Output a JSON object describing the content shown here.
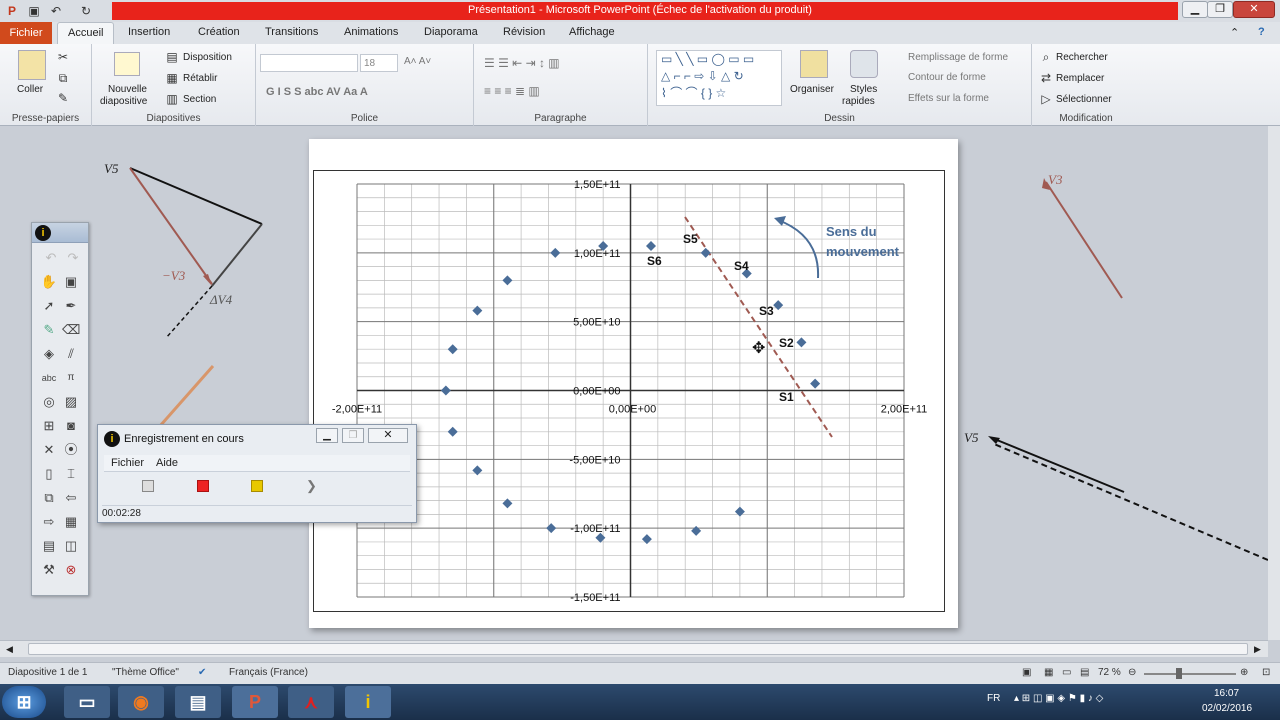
{
  "window": {
    "title": "Présentation1  -  Microsoft PowerPoint (Échec de l'activation du produit)",
    "controls": [
      "minimize",
      "restore",
      "close"
    ]
  },
  "tabs": [
    {
      "label": "Fichier"
    },
    {
      "label": "Accueil"
    },
    {
      "label": "Insertion"
    },
    {
      "label": "Création"
    },
    {
      "label": "Transitions"
    },
    {
      "label": "Animations"
    },
    {
      "label": "Diaporama"
    },
    {
      "label": "Révision"
    },
    {
      "label": "Affichage"
    }
  ],
  "ribbon": {
    "clipboard": {
      "paste": "Coller",
      "group": "Presse-papiers"
    },
    "slides": {
      "new_slide_1": "Nouvelle",
      "new_slide_2": "diapositive",
      "layout": "Disposition",
      "reset": "Rétablir",
      "section": "Section",
      "group": "Diapositives"
    },
    "font": {
      "size": "18",
      "group": "Police"
    },
    "paragraph": {
      "group": "Paragraphe"
    },
    "drawing": {
      "arrange": "Organiser",
      "quick_styles_1": "Styles",
      "quick_styles_2": "rapides",
      "fill": "Remplissage de forme",
      "outline": "Contour de forme",
      "effects": "Effets sur la forme",
      "group": "Dessin"
    },
    "editing": {
      "find": "Rechercher",
      "replace": "Remplacer",
      "select": "Sélectionner",
      "group": "Modification"
    }
  },
  "slide_labels": {
    "v5": "V5",
    "neg_v3": "−V3",
    "delta_v4": "ΔV4",
    "v3": "V3",
    "v5b": "V5",
    "sens1": "Sens du",
    "sens2": "mouvement",
    "s_labels": [
      "S5",
      "S6",
      "S4",
      "S3",
      "S2",
      "S1"
    ]
  },
  "chart_data": {
    "type": "scatter",
    "x": [
      135000000000.0,
      125000000000.0,
      108000000000.0,
      85000000000.0,
      55000000000.0,
      15000000000.0,
      -20000000000.0,
      -55000000000.0,
      -90000000000.0,
      -112000000000.0,
      -130000000000.0,
      -135000000000.0,
      -130000000000.0,
      -112000000000.0,
      -90000000000.0,
      -58000000000.0,
      -22000000000.0,
      12000000000.0,
      48000000000.0,
      80000000000.0
    ],
    "y": [
      5000000000.0,
      35000000000.0,
      62000000000.0,
      85000000000.0,
      100000000000.0,
      105000000000.0,
      105000000000.0,
      100000000000.0,
      80000000000.0,
      58000000000.0,
      30000000000.0,
      0.0,
      -30000000000.0,
      -58000000000.0,
      -82000000000.0,
      -100000000000.0,
      -107000000000.0,
      -108000000000.0,
      -102000000000.0,
      -88000000000.0
    ],
    "xlim": [
      -200000000000.0,
      200000000000.0
    ],
    "ylim": [
      -150000000000.0,
      150000000000.0
    ],
    "x_ticks": [
      "-2,00E+11",
      "0,00E+00",
      "2,00E+11"
    ],
    "y_ticks": [
      "1,50E+11",
      "1,00E+11",
      "5,00E+10",
      "0,00E+00",
      "-5,00E+10",
      "-1,00E+11",
      "-1,50E+11"
    ],
    "grid": true,
    "marker_color": "#4a6d98"
  },
  "recorder": {
    "title": "Enregistrement en cours",
    "menu": [
      "Fichier",
      "Aide"
    ],
    "time": "00:02:28"
  },
  "status_bar": {
    "slide": "Diapositive 1 de 1",
    "theme": "\"Thème Office\"",
    "language": "Français (France)",
    "zoom": "72 %"
  },
  "taskbar": {
    "lang": "FR",
    "time": "16:07",
    "date": "02/02/2016"
  },
  "colors": {
    "title_red": "#e8231b",
    "file_tab": "#d14a1c",
    "vector_brown": "#a05a52",
    "sens_blue": "#4a6d98"
  }
}
